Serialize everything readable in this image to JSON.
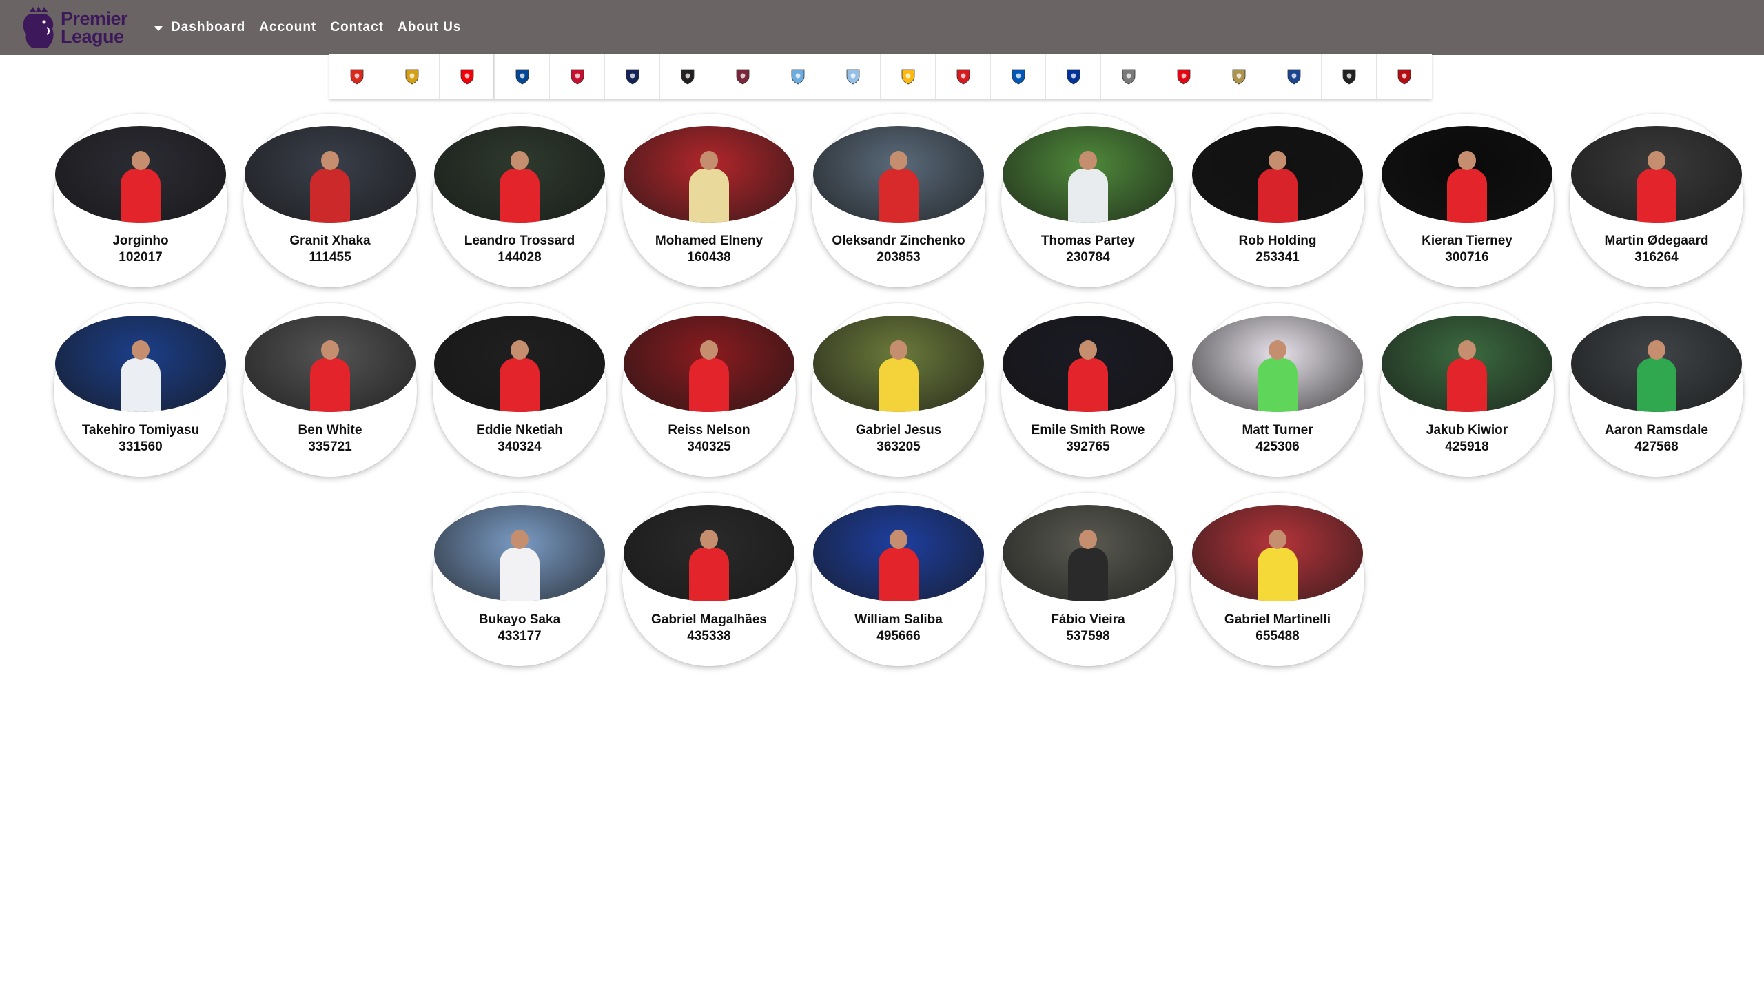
{
  "app": {
    "logo": {
      "line1": "Premier",
      "line2": "League"
    },
    "nav": [
      "Dashboard",
      "Account",
      "Contact",
      "About Us"
    ]
  },
  "clubs": [
    {
      "icon": "manchester-united-crest",
      "color": "#da291c",
      "active": false
    },
    {
      "icon": "wolves-like-crest",
      "color": "#d4a017",
      "active": false
    },
    {
      "icon": "arsenal-crest",
      "color": "#ef0107",
      "active": true
    },
    {
      "icon": "chelsea-crest",
      "color": "#034694",
      "active": false
    },
    {
      "icon": "liverpool-crest",
      "color": "#c8102e",
      "active": false
    },
    {
      "icon": "tottenham-crest",
      "color": "#132257",
      "active": false
    },
    {
      "icon": "newcastle-crest",
      "color": "#241f20",
      "active": false
    },
    {
      "icon": "west-ham-crest",
      "color": "#7a263a",
      "active": false
    },
    {
      "icon": "manchester-city-crest",
      "color": "#6cabdd",
      "active": false
    },
    {
      "icon": "aston-villa-crest",
      "color": "#95bfe5",
      "active": false
    },
    {
      "icon": "wolverhampton-crest",
      "color": "#fdb913",
      "active": false
    },
    {
      "icon": "southampton-crest",
      "color": "#d71920",
      "active": false
    },
    {
      "icon": "brighton-crest",
      "color": "#0057b8",
      "active": false
    },
    {
      "icon": "everton-crest",
      "color": "#003399",
      "active": false
    },
    {
      "icon": "nottingham-forest-crest",
      "color": "#7a7a7a",
      "active": false
    },
    {
      "icon": "brentford-crest",
      "color": "#e30613",
      "active": false
    },
    {
      "icon": "leeds-crest",
      "color": "#ac944d",
      "active": false
    },
    {
      "icon": "crystal-palace-crest",
      "color": "#1b458f",
      "active": false
    },
    {
      "icon": "fulham-crest",
      "color": "#222222",
      "active": false
    },
    {
      "icon": "bournemouth-crest",
      "color": "#b50e12",
      "active": false
    }
  ],
  "players": [
    {
      "name": "Jorginho",
      "id": "102017",
      "bg": "#2b2b33",
      "kit": "#e4242b"
    },
    {
      "name": "Granit Xhaka",
      "id": "111455",
      "bg": "#3a3f4a",
      "kit": "#cc2a2a"
    },
    {
      "name": "Leandro Trossard",
      "id": "144028",
      "bg": "#2e3a2e",
      "kit": "#e4242b"
    },
    {
      "name": "Mohamed Elneny",
      "id": "160438",
      "bg": "#b3262b",
      "kit": "#e9d99a"
    },
    {
      "name": "Oleksandr Zinchenko",
      "id": "203853",
      "bg": "#5a6a7a",
      "kit": "#d82a2a"
    },
    {
      "name": "Thomas Partey",
      "id": "230784",
      "bg": "#4f8a3a",
      "kit": "#e8ecef"
    },
    {
      "name": "Rob Holding",
      "id": "253341",
      "bg": "#111111",
      "kit": "#d9232a"
    },
    {
      "name": "Kieran Tierney",
      "id": "300716",
      "bg": "#0a0a0a",
      "kit": "#e4242b"
    },
    {
      "name": "Martin Ødegaard",
      "id": "316264",
      "bg": "#3a3a3a",
      "kit": "#e4242b"
    },
    {
      "name": "Takehiro Tomiyasu",
      "id": "331560",
      "bg": "#1c3f8a",
      "kit": "#ebeef2"
    },
    {
      "name": "Ben White",
      "id": "335721",
      "bg": "#545454",
      "kit": "#e4242b"
    },
    {
      "name": "Eddie Nketiah",
      "id": "340324",
      "bg": "#1f1f1f",
      "kit": "#e4242b"
    },
    {
      "name": "Reiss Nelson",
      "id": "340325",
      "bg": "#8a1b1f",
      "kit": "#e4242b"
    },
    {
      "name": "Gabriel Jesus",
      "id": "363205",
      "bg": "#6b7a3a",
      "kit": "#f3d23a"
    },
    {
      "name": "Emile Smith Rowe",
      "id": "392765",
      "bg": "#1a1a24",
      "kit": "#e4242b"
    },
    {
      "name": "Matt Turner",
      "id": "425306",
      "bg": "#e7e2ea",
      "kit": "#5fd65a"
    },
    {
      "name": "Jakub Kiwior",
      "id": "425918",
      "bg": "#3b6a3f",
      "kit": "#e4242b"
    },
    {
      "name": "Aaron Ramsdale",
      "id": "427568",
      "bg": "#3f4448",
      "kit": "#2fa84f"
    },
    {
      "name": "Bukayo Saka",
      "id": "433177",
      "bg": "#7a9bc4",
      "kit": "#f2f2f5"
    },
    {
      "name": "Gabriel Magalhães",
      "id": "435338",
      "bg": "#2a2a2a",
      "kit": "#e4242b"
    },
    {
      "name": "William Saliba",
      "id": "495666",
      "bg": "#1e3fa0",
      "kit": "#e4242b"
    },
    {
      "name": "Fábio Vieira",
      "id": "537598",
      "bg": "#5a5a52",
      "kit": "#2a2a2a"
    },
    {
      "name": "Gabriel Martinelli",
      "id": "655488",
      "bg": "#b5343a",
      "kit": "#f5d938"
    }
  ]
}
